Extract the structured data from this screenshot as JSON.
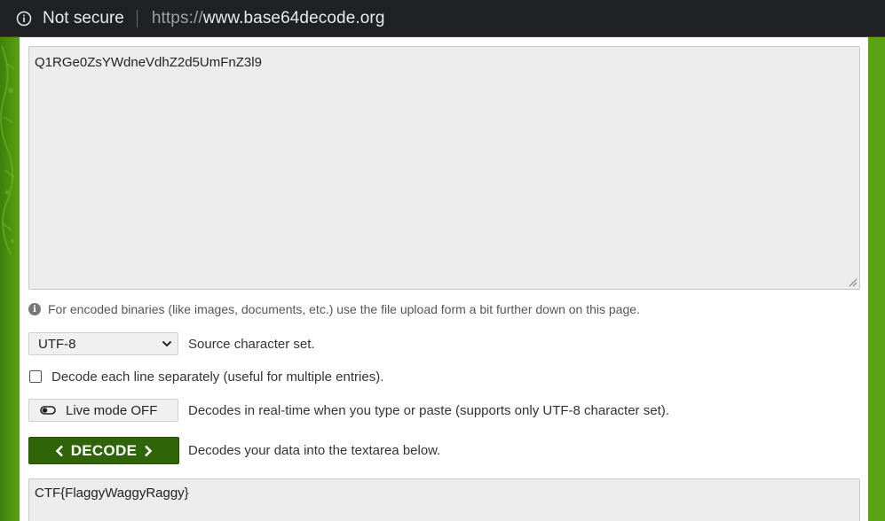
{
  "browser": {
    "security_label": "Not secure",
    "url_scheme": "https://",
    "url_host": "www.base64decode.org",
    "info_icon": "info-icon"
  },
  "form": {
    "input_value": "Q1RGe0ZsYWdneVdhZ2d5UmFnZ3l9",
    "hint": "For encoded binaries (like images, documents, etc.) use the file upload form a bit further down on this page.",
    "charset": {
      "selected": "UTF-8",
      "description": "Source character set."
    },
    "decode_lines": {
      "checked": false,
      "label": "Decode each line separately (useful for multiple entries)."
    },
    "live_mode": {
      "button_label": "Live mode OFF",
      "description": "Decodes in real-time when you type or paste (supports only UTF-8 character set)."
    },
    "decode": {
      "button_label": "DECODE",
      "description": "Decodes your data into the textarea below."
    },
    "output_value": "CTF{FlaggyWaggyRaggy}"
  },
  "colors": {
    "page_green": "#5aa213",
    "button_green": "#2f6409",
    "field_bg": "#ececec"
  }
}
